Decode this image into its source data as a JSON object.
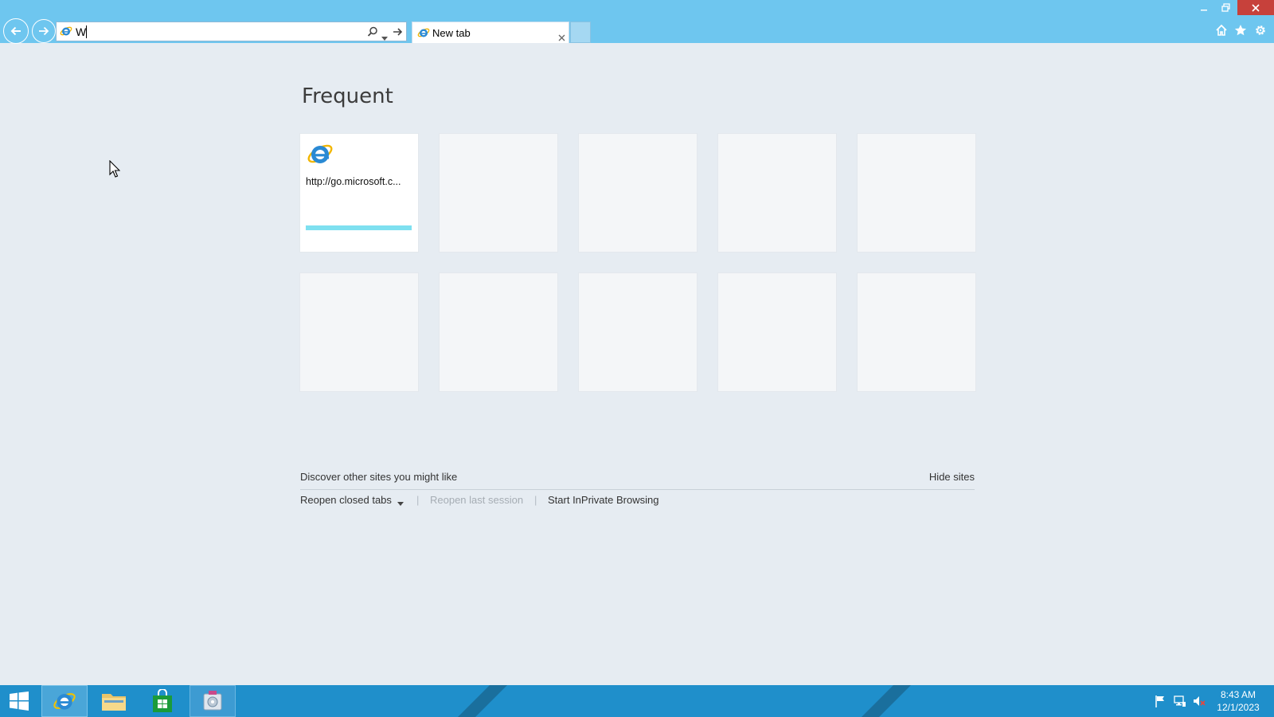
{
  "browser": {
    "address_bar": {
      "value": "W",
      "placeholder": ""
    },
    "tabs": [
      {
        "label": "New tab"
      }
    ]
  },
  "new_tab_page": {
    "title": "Frequent",
    "tiles": [
      {
        "label": "http://go.microsoft.c...",
        "icon": "ie-icon",
        "has_progress": true
      },
      {
        "label": ""
      },
      {
        "label": ""
      },
      {
        "label": ""
      },
      {
        "label": ""
      },
      {
        "label": ""
      },
      {
        "label": ""
      },
      {
        "label": ""
      },
      {
        "label": ""
      },
      {
        "label": ""
      }
    ],
    "discover_text": "Discover other sites you might like",
    "hide_sites_label": "Hide sites",
    "reopen_closed_tabs_label": "Reopen closed tabs",
    "reopen_last_session_label": "Reopen last session",
    "separator": "|",
    "inprivate_label": "Start InPrivate Browsing"
  },
  "taskbar": {
    "clock_time": "8:43 AM",
    "clock_date": "12/1/2023",
    "items": [
      "start-icon",
      "ie-icon",
      "file-explorer-icon",
      "store-icon",
      "app-icon"
    ]
  },
  "colors": {
    "titlebar": "#6ec6ef",
    "page_background": "#e6ecf2",
    "taskbar": "#1f8fcb",
    "close_button": "#c7413b",
    "progress_bar": "#7ee0f0"
  }
}
